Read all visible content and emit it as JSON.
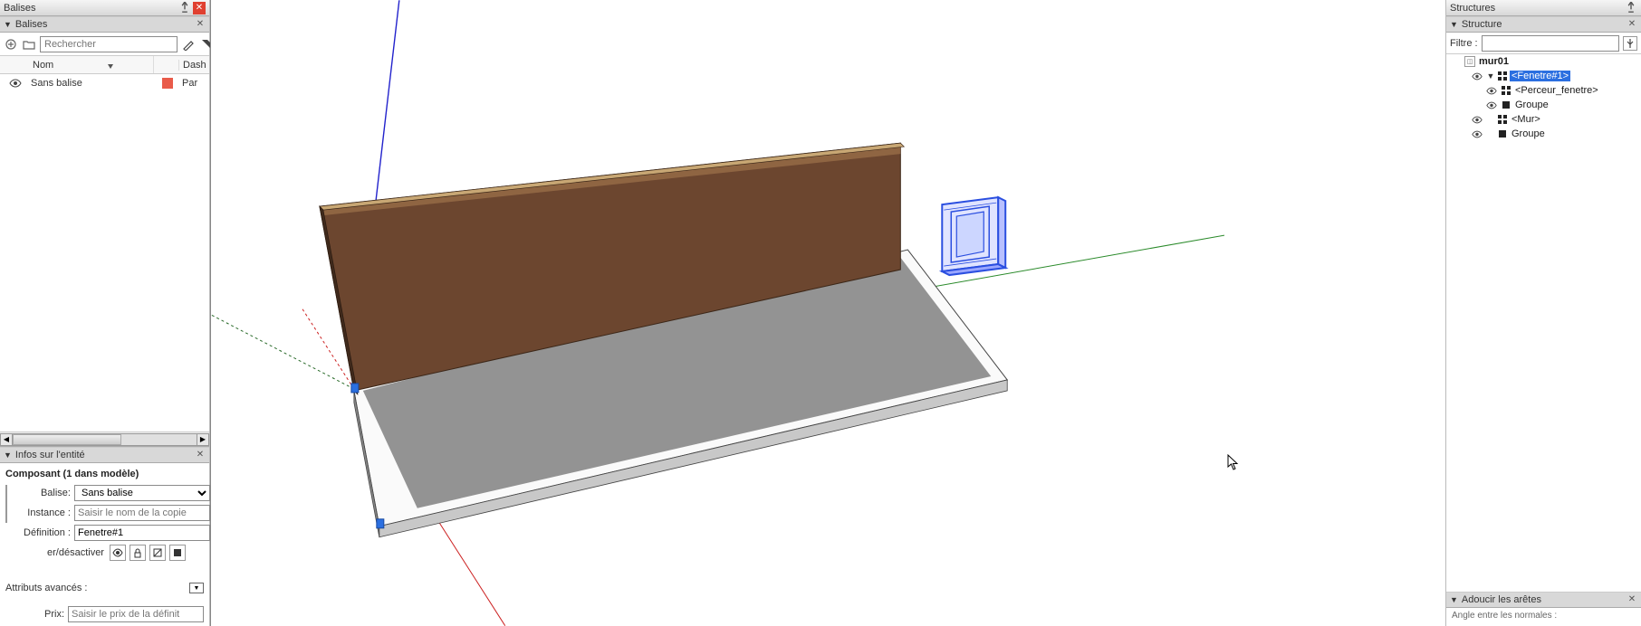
{
  "left": {
    "panel_title": "Balises",
    "section_title": "Balises",
    "search_placeholder": "Rechercher",
    "col_nom": "Nom",
    "col_dash": "Dash",
    "row0_name": "Sans balise",
    "row0_dash": "Par",
    "row0_color": "#e95b4a"
  },
  "entity": {
    "section_title": "Infos sur l'entité",
    "title": "Composant (1 dans modèle)",
    "balise_label": "Balise:",
    "balise_value": "Sans balise",
    "instance_label": "Instance :",
    "instance_placeholder": "Saisir le nom de la copie",
    "definition_label": "Définition :",
    "definition_value": "Fenetre#1",
    "toggle_label": "er/désactiver",
    "adv_label": "Attributs avancés :",
    "prix_label": "Prix:",
    "prix_placeholder": "Saisir le prix de la définit"
  },
  "right": {
    "panel_title": "Structures",
    "section_title": "Structure",
    "filter_label": "Filtre :",
    "tree_model": "mur01",
    "tree_fenetre": "<Fenetre#1>",
    "tree_perceur": "<Perceur_fenetre>",
    "tree_groupe1": "Groupe",
    "tree_mur": "<Mur>",
    "tree_groupe2": "Groupe",
    "adoucir_title": "Adoucir les arêtes",
    "angle_label": "Angle entre les normales :"
  }
}
